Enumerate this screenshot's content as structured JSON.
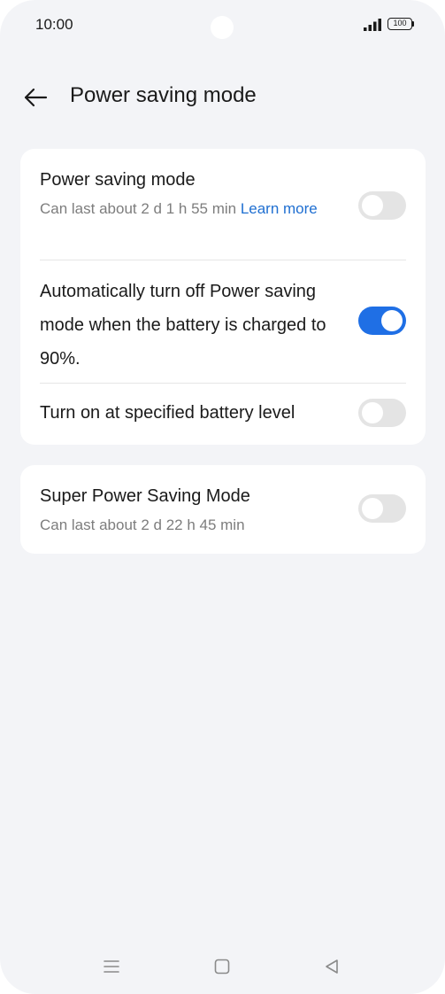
{
  "status_bar": {
    "time": "10:00",
    "battery": "100",
    "icons": [
      "signal-icon",
      "battery-icon"
    ]
  },
  "header": {
    "title": "Power saving mode",
    "back_icon": "arrow-left-icon"
  },
  "card1": {
    "power_saving": {
      "title": "Power saving mode",
      "subtitle": "Can last about 2 d 1 h 55 min ",
      "link": "Learn more",
      "enabled": false
    },
    "auto_off": {
      "title": "Automatically turn off Power saving mode when the battery is charged to 90%.",
      "enabled": true
    },
    "specified_level": {
      "title": "Turn on at specified battery level",
      "enabled": false
    }
  },
  "card2": {
    "super_saving": {
      "title": "Super Power Saving Mode",
      "subtitle": "Can last about 2 d 22 h 45 min",
      "enabled": false
    }
  },
  "nav_bar": {
    "icons": [
      "menu-icon",
      "home-icon",
      "back-triangle-icon"
    ]
  },
  "colors": {
    "accent": "#1f6fe5",
    "link": "#1f6fd1",
    "background": "#f3f4f7"
  }
}
